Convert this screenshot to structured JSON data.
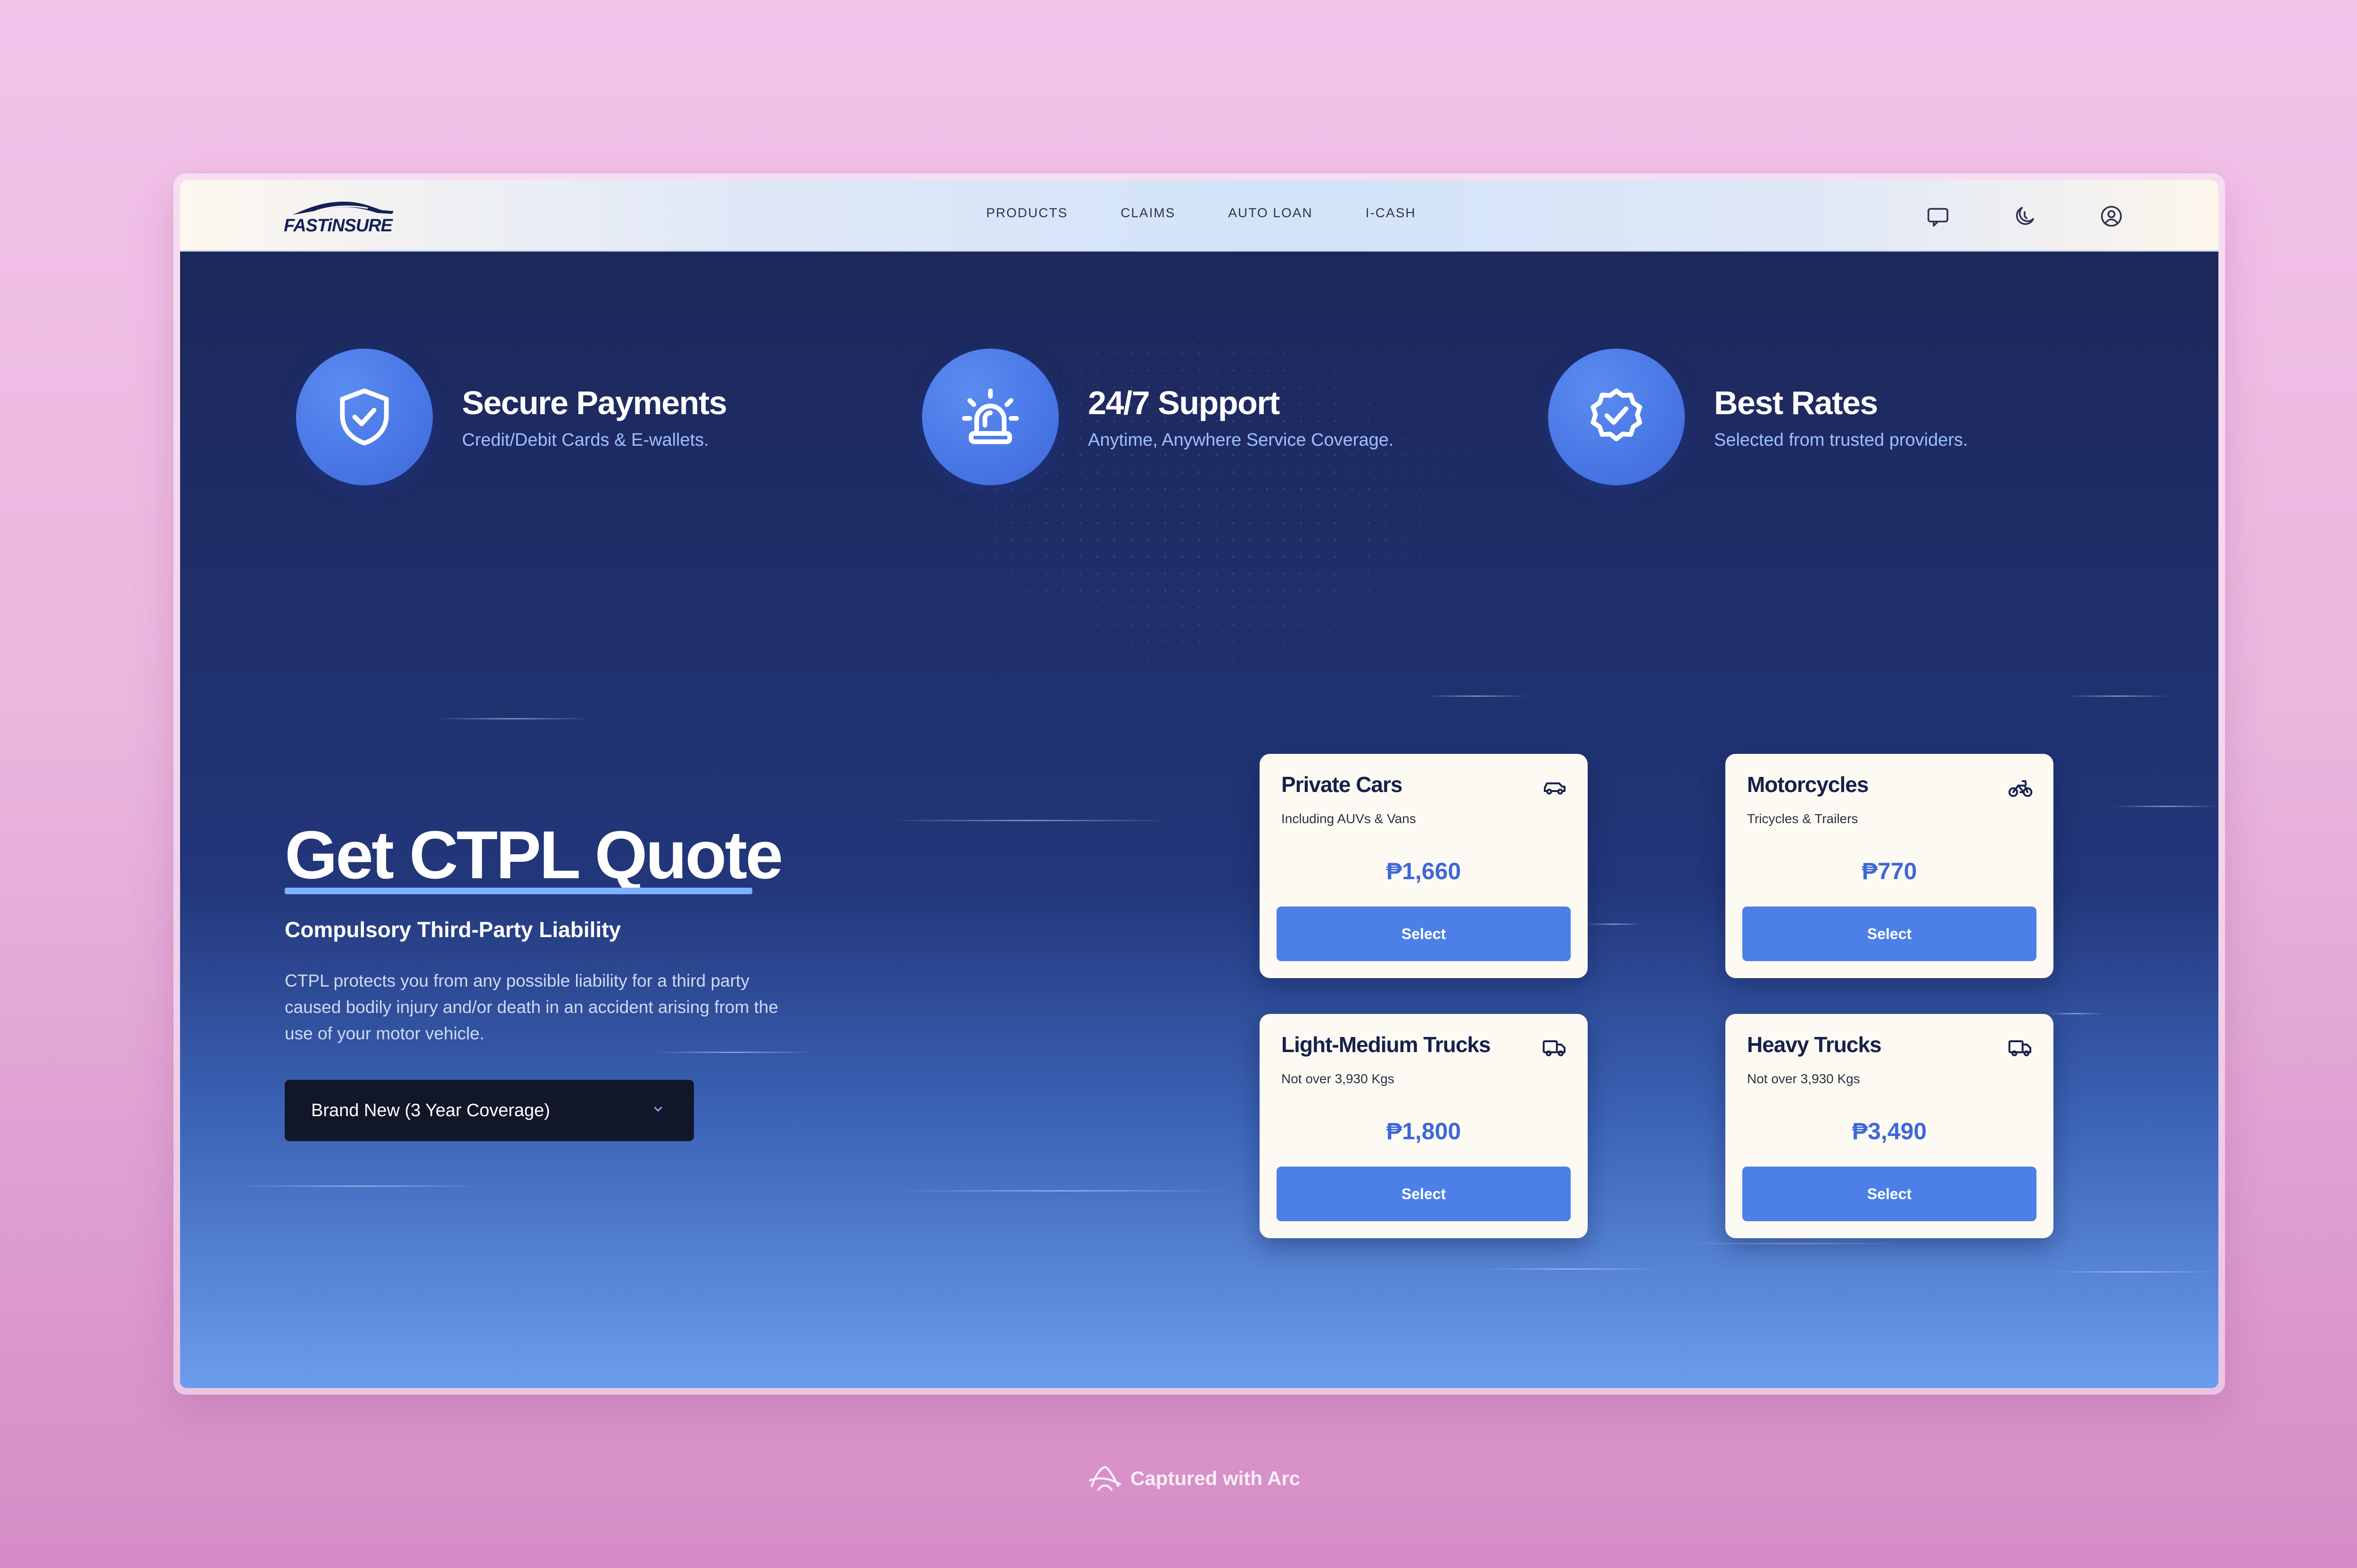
{
  "brand": {
    "logo_text": "FASTiNSURE",
    "logo_icon": "car-silhouette-icon"
  },
  "nav": {
    "menu": [
      "PRODUCTS",
      "CLAIMS",
      "AUTO LOAN",
      "I-CASH"
    ],
    "icons": [
      "chat-icon",
      "moon-icon",
      "user-circle-icon"
    ]
  },
  "features": [
    {
      "title": "Secure Payments",
      "subtitle": "Credit/Debit Cards & E-wallets.",
      "icon": "shield-check-icon"
    },
    {
      "title": "24/7 Support",
      "subtitle": "Anytime, Anywhere Service Coverage.",
      "icon": "siren-icon"
    },
    {
      "title": "Best Rates",
      "subtitle": "Selected from trusted providers.",
      "icon": "badge-check-icon"
    }
  ],
  "hero": {
    "title": "Get CTPL Quote",
    "subtitle": "Compulsory Third-Party Liability",
    "description": "CTPL protects you from any possible liability for a third party caused bodily injury and/or death in an accident arising from the use of your motor vehicle.",
    "coverage_select": "Brand New (3 Year Coverage)"
  },
  "cards": [
    {
      "title": "Private Cars",
      "subtitle": "Including AUVs & Vans",
      "price": "₱1,660",
      "button": "Select",
      "icon": "car-icon"
    },
    {
      "title": "Motorcycles",
      "subtitle": "Tricycles & Trailers",
      "price": "₱770",
      "button": "Select",
      "icon": "bicycle-icon"
    },
    {
      "title": "Light-Medium Trucks",
      "subtitle": "Not over 3,930 Kgs",
      "price": "₱1,800",
      "button": "Select",
      "icon": "truck-icon"
    },
    {
      "title": "Heavy Trucks",
      "subtitle": "Not over 3,930 Kgs",
      "price": "₱3,490",
      "button": "Select",
      "icon": "truck-icon"
    }
  ],
  "footer": {
    "arc_label": "Captured with Arc",
    "arc_icon": "arc-logo-icon"
  },
  "colors": {
    "accent": "#4c80e8",
    "price": "#3e68d8",
    "nav_text": "#2b3350",
    "hero_bg": "#1f2d66"
  }
}
